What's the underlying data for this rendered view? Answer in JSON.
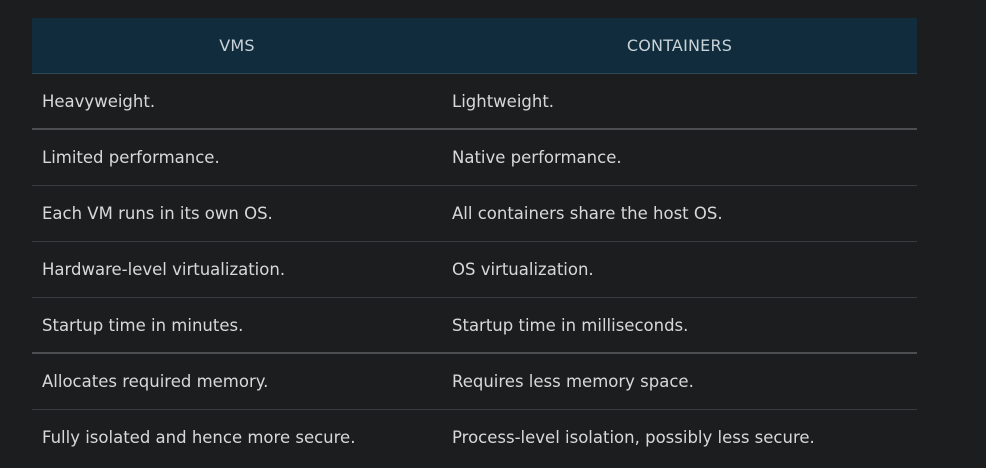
{
  "table": {
    "headers": [
      "VMS",
      "CONTAINERS"
    ],
    "rows": [
      [
        "Heavyweight.",
        "Lightweight."
      ],
      [
        "Limited performance.",
        "Native performance."
      ],
      [
        "Each VM runs in its own OS.",
        "All containers share the host OS."
      ],
      [
        "Hardware-level virtualization.",
        "OS virtualization."
      ],
      [
        "Startup time in minutes.",
        "Startup time in milliseconds."
      ],
      [
        "Allocates required memory.",
        "Requires less memory space."
      ],
      [
        "Fully isolated and hence more secure.",
        "Process-level isolation, possibly less secure."
      ]
    ]
  },
  "colors": {
    "background": "#1c1d1f",
    "header_background": "#112d3d",
    "header_text": "#c9d3d8",
    "cell_text": "#d8d8d8"
  }
}
